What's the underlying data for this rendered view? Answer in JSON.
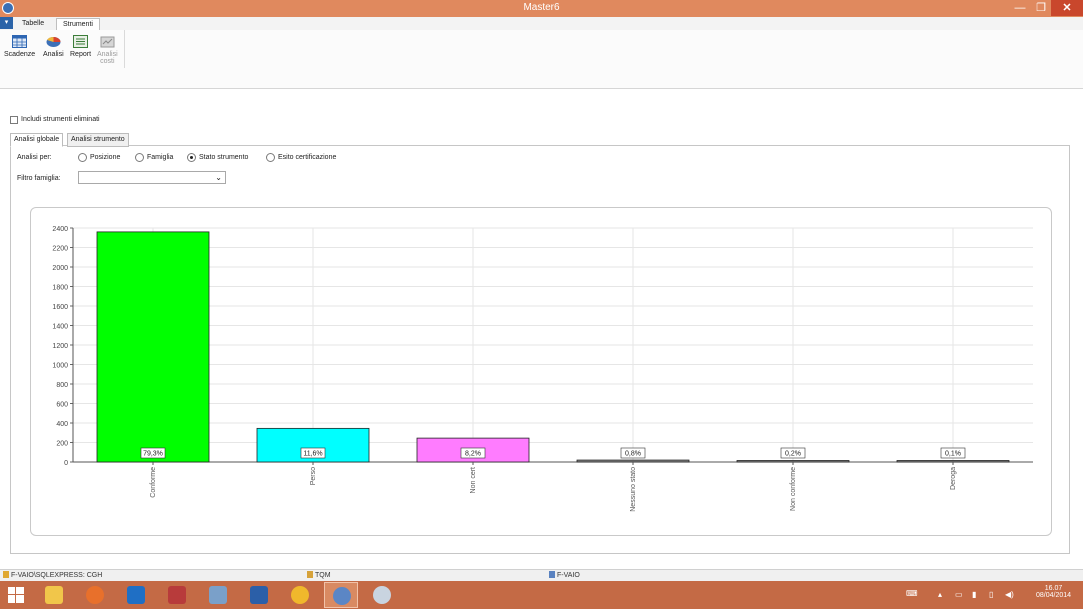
{
  "window": {
    "title": "Master6",
    "minimize": "—",
    "maximize": "❐",
    "close": "✕"
  },
  "ribbon": {
    "menu_glyph": "▾",
    "tabs": [
      {
        "label": "Tabelle"
      },
      {
        "label": "Strumenti"
      }
    ],
    "buttons": [
      {
        "label": "Scadenze",
        "icon": "calendar-grid-icon"
      },
      {
        "label": "Analisi",
        "icon": "pie-chart-icon"
      },
      {
        "label": "Report",
        "icon": "report-icon"
      },
      {
        "label": "Analisi",
        "label2": "costi",
        "icon": "cost-analysis-icon"
      }
    ]
  },
  "content": {
    "include_deleted_label": "Includi strumenti eliminati",
    "tabs": [
      {
        "label": "Analisi globale"
      },
      {
        "label": "Analisi strumento"
      }
    ],
    "analysis_label": "Analisi per:",
    "radios": [
      {
        "label": "Posizione",
        "selected": false
      },
      {
        "label": "Famiglia",
        "selected": false
      },
      {
        "label": "Stato strumento",
        "selected": true
      },
      {
        "label": "Esito certificazione",
        "selected": false
      }
    ],
    "family_filter_label": "Filtro famiglia:",
    "family_filter_value": ""
  },
  "chart_data": {
    "type": "bar",
    "categories": [
      "Conforme",
      "Perso",
      "Non cert",
      "Nessuno stato",
      "Non conforme",
      "Deroga"
    ],
    "values": [
      2360,
      345,
      245,
      20,
      8,
      4
    ],
    "data_labels": [
      "79,3%",
      "11,6%",
      "8,2%",
      "0,8%",
      "0,2%",
      "0,1%"
    ],
    "colors": [
      "#00ff00",
      "#00ffff",
      "#ff7cff",
      "#8a8a8a",
      "#8a8a8a",
      "#8a8a8a"
    ],
    "ylim": [
      0,
      2400
    ],
    "yticks": [
      0,
      200,
      400,
      600,
      800,
      1000,
      1200,
      1400,
      1600,
      1800,
      2000,
      2200,
      2400
    ],
    "grid": true
  },
  "statusbar": {
    "server": "F-VAIO\\SQLEXPRESS: CGH",
    "database": "TQM",
    "machine": "F-VAIO"
  },
  "taskbar": {
    "apps": [
      "windows-start-icon",
      "file-explorer-icon",
      "firefox-icon",
      "outlook-icon",
      "access-icon",
      "calculator-icon",
      "word-icon",
      "paint-icon",
      "master6-app-icon",
      "photo-app-icon"
    ],
    "time": "16.07",
    "date": "08/04/2014"
  },
  "colors": {
    "titlebar": "#e0895e",
    "taskbar": "#c46a45",
    "close": "#c9472c",
    "accent": "#2a63a8"
  }
}
